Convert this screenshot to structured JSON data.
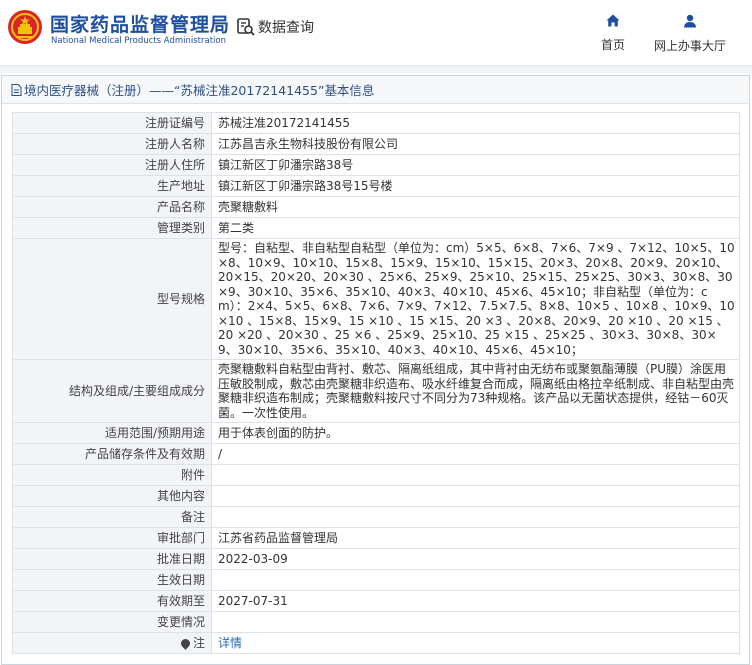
{
  "header": {
    "brand_cn": "国家药品监督管理局",
    "brand_en": "National Medical Products Administration",
    "query_label": "数据查询",
    "nav": {
      "home": "首页",
      "hall": "网上办事大厅"
    },
    "accent": "#1f4f9f"
  },
  "panel": {
    "title": "境内医疗器械（注册）——“苏械注准20172141455”基本信息"
  },
  "rows": [
    {
      "label": "注册证编号",
      "value": "苏械注准20172141455"
    },
    {
      "label": "注册人名称",
      "value": "江苏昌吉永生物科技股份有限公司"
    },
    {
      "label": "注册人住所",
      "value": "镇江新区丁卯潘宗路38号"
    },
    {
      "label": "生产地址",
      "value": "镇江新区丁卯潘宗路38号15号楼"
    },
    {
      "label": "产品名称",
      "value": "壳聚糖敷料"
    },
    {
      "label": "管理类别",
      "value": "第二类"
    },
    {
      "label": "型号规格",
      "value": "型号：自粘型、非自粘型自粘型（单位为：cm）5×5、6×8、7×6、7×9 、7×12、10×5、10×8、10×9、10×10、15×8、15×9、15×10、15×15、20×3、20×8、20×9、20×10、20×15、20×20、20×30 、25×6、25×9、25×10、25×15、25×25、30×3、30×8、30×9、30×10、35×6、35×10、40×3、40×10、45×6、45×10；非自粘型（单位为：cm）：2×4、5×5、6×8、7×6、7×9、7×12、7.5×7.5、8×8、10×5 、10×8 、10×9、10 ×10 、15×8、15×9、15 ×10 、15 ×15、20 ×3 、20×8、20×9、20 ×10 、20 ×15 、20 ×20 、20×30 、25 ×6 、25×9、25×10、25 ×15 、25×25 、30×3、30×8、30×9、30×10、35×6、35×10、40×3、40×10、45×6、45×10；"
    },
    {
      "label": "结构及组成/主要组成成分",
      "value": "壳聚糖敷料自粘型由背衬、敷芯、隔离纸组成，其中背衬由无纺布或聚氨酯薄膜（PU膜）涂医用压敏胶制成，敷芯由壳聚糖非织造布、吸水纤维复合而成，隔离纸由格拉辛纸制成、非自粘型由壳聚糖非织造布制成；壳聚糖敷料按尺寸不同分为73种规格。该产品以无菌状态提供，经钴－60灭菌。一次性使用。"
    },
    {
      "label": "适用范围/预期用途",
      "value": "用于体表创面的防护。"
    },
    {
      "label": "产品储存条件及有效期",
      "value": "/"
    },
    {
      "label": "附件",
      "value": ""
    },
    {
      "label": "其他内容",
      "value": ""
    },
    {
      "label": "备注",
      "value": ""
    },
    {
      "label": "审批部门",
      "value": "江苏省药品监督管理局"
    },
    {
      "label": "批准日期",
      "value": "2022-03-09"
    },
    {
      "label": "生效日期",
      "value": ""
    },
    {
      "label": "有效期至",
      "value": "2027-07-31"
    },
    {
      "label": "变更情况",
      "value": ""
    },
    {
      "label": "注",
      "value": "详情",
      "is_link": true
    }
  ]
}
